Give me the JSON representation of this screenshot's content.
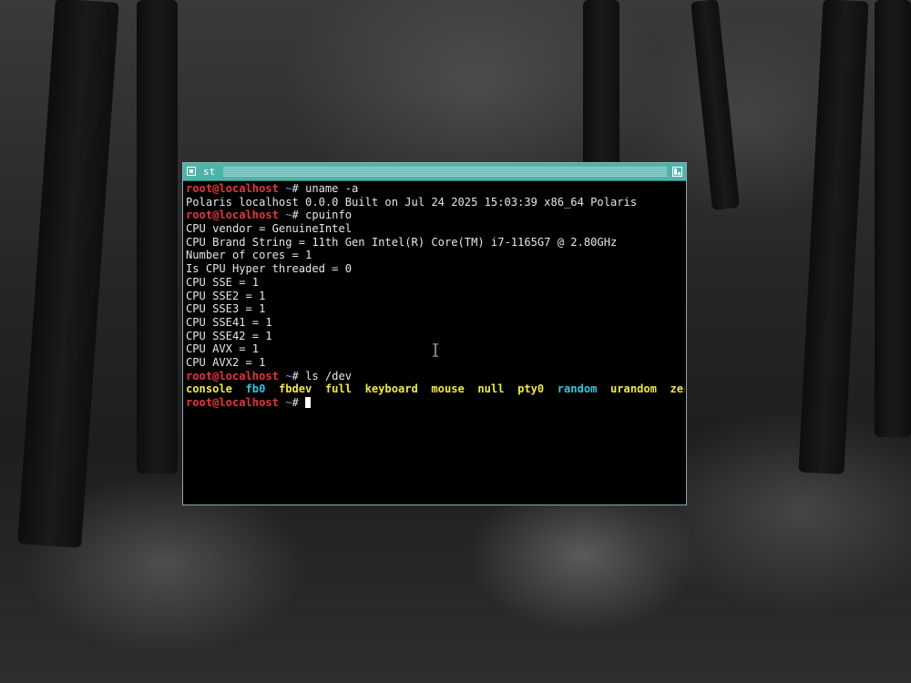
{
  "window": {
    "title": "st"
  },
  "prompt": {
    "user_host": "root@localhost",
    "path": "~",
    "symbol": "#"
  },
  "session": [
    {
      "type": "command",
      "text": "uname -a"
    },
    {
      "type": "output",
      "text": "Polaris localhost 0.0.0 Built on Jul 24 2025 15:03:39 x86_64 Polaris"
    },
    {
      "type": "command",
      "text": "cpuinfo"
    },
    {
      "type": "output",
      "text": "CPU vendor = GenuineIntel"
    },
    {
      "type": "output",
      "text": "CPU Brand String = 11th Gen Intel(R) Core(TM) i7-1165G7 @ 2.80GHz"
    },
    {
      "type": "output",
      "text": "Number of cores = 1"
    },
    {
      "type": "output",
      "text": "Is CPU Hyper threaded = 0"
    },
    {
      "type": "output",
      "text": "CPU SSE = 1"
    },
    {
      "type": "output",
      "text": "CPU SSE2 = 1"
    },
    {
      "type": "output",
      "text": "CPU SSE3 = 1"
    },
    {
      "type": "output",
      "text": "CPU SSE41 = 1"
    },
    {
      "type": "output",
      "text": "CPU SSE42 = 1"
    },
    {
      "type": "output",
      "text": "CPU AVX = 1"
    },
    {
      "type": "output",
      "text": "CPU AVX2 = 1"
    },
    {
      "type": "command",
      "text": "ls /dev"
    }
  ],
  "dev_listing": [
    {
      "name": "console",
      "color": "yellow"
    },
    {
      "name": "fb0",
      "color": "cyan"
    },
    {
      "name": "fbdev",
      "color": "yellow"
    },
    {
      "name": "full",
      "color": "yellow"
    },
    {
      "name": "keyboard",
      "color": "yellow"
    },
    {
      "name": "mouse",
      "color": "yellow"
    },
    {
      "name": "null",
      "color": "yellow"
    },
    {
      "name": "pty0",
      "color": "yellow"
    },
    {
      "name": "random",
      "color": "cyan"
    },
    {
      "name": "urandom",
      "color": "yellow"
    },
    {
      "name": "zero",
      "color": "yellow"
    }
  ],
  "icons": {
    "window_menu": "window-menu-icon",
    "maximize": "maximize-icon",
    "mouse_pointer": "text-cursor-icon"
  },
  "colors": {
    "titlebar": "#4fb3a9",
    "prompt_user": "#e8343a",
    "prompt_path": "#7f8fff",
    "dev_yellow": "#f2ea3d",
    "dev_cyan": "#2fc8e0",
    "terminal_bg": "#000000",
    "terminal_fg": "#e6e6e6"
  }
}
